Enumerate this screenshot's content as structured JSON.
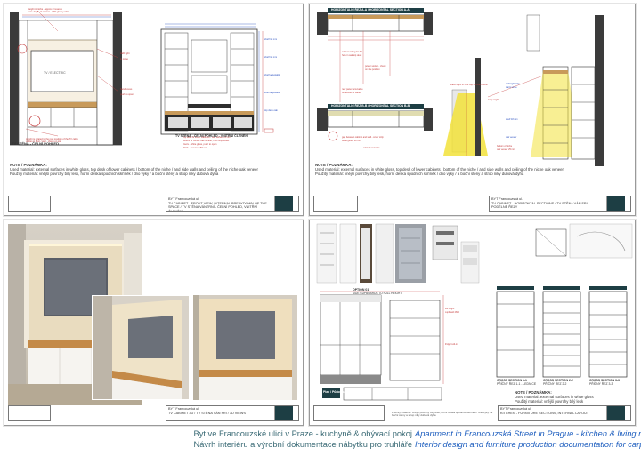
{
  "sheets": {
    "top_left": {
      "labels": {
        "view_left": "TV STĚNA - ČELNÍ POHLED",
        "view_right": "TV STĚNA - ČELNÍ POHLED - VNITŘNÍ ČLENĚNÍ"
      },
      "note_title": "NOTE / POZNÁMKA:",
      "note_en": "Used material: external surfaces in white gloss, top desk of lower cabinets / bottom of the niche / and side walls and ceiling of the niche oak veneer",
      "note_cz": "Použitý materiál: vnější povrchy bílý lesk, horní deska spodních skříněk / dno výky / a boční stěny a strop niky dubová dýha",
      "title_block": {
        "company": "BYT Francouzská ul.",
        "description": "TV CABINET - FRONT VIEW, INTERNAL BREAKDOWN OF THE SPACE / TV STĚNA VÁNTRNÍ - ČELNÍ POHLED, VNITŘNÍ ČLENĚNÍ"
      }
    },
    "top_right": {
      "labels": {
        "plan_a": "HORIZONTÁLNÍ ŘEZ A-A / HORIZONTAL SECTION A-A",
        "plan_b": "HORIZONTÁLNÍ ŘEZ B-B / HORIZONTAL SECTION B-B",
        "light_note": "LED light in the top of the niche"
      },
      "note_title": "NOTE / POZNÁMKA:",
      "note_en": "Used material: external surfaces in white gloss, top desk of lower cabinets / bottom of the niche / and side walls and ceiling of the niche oak veneer",
      "note_cz": "Použitý materiál: vnější povrchy bílý lesk, horní deska spodních skříněk / dno výky / a boční stěny a strop niky dubová dýha",
      "title_block": {
        "company": "BYT Francouzská ul.",
        "description": "TV CABINET - HORIZONTAL SECTIONS / TV STĚNA VÁN FRI - PODÉLNÉ ŘEZY"
      }
    },
    "bottom_left": {
      "title_block": {
        "company": "BYT Francouzská ul.",
        "description": "TV CABINET 3D / TV STĚNA VÁN FRI / 3D VIEWS"
      }
    },
    "bottom_right": {
      "labels": {
        "option": "OPTION 01",
        "option_desc": "SIDE CUPBOARDS TO FULL HEIGHT",
        "section_1": "CROSS SECTION 1-1",
        "section_1_cz": "PŘÍČNÝ ŘEZ 1-1 - LEDNICE",
        "section_2": "CROSS SECTION 2-2",
        "section_2_cz": "PŘÍČNÝ ŘEZ 2-2",
        "section_3": "CROSS SECTION 3-3",
        "section_3_cz": "PŘÍČNÝ ŘEZ 3-3",
        "plan": "Plan / Půdorys",
        "sprinkler_label": "Wall spacer"
      },
      "note_title": "NOTE / POZNÁMKA:",
      "note_en": "Used material: external surfaces in white gloss",
      "note_cz": "Použitý materiál: vnější povrchy bílý lesk",
      "footer_note": "Použitý materiál: vnější povrchy bílý lesk, horní deska spodních skříněk / dno výky / a boční stěny a strop niky dubová dýha",
      "title_block": {
        "company": "BYT Francouzská ul.",
        "description": "KITCHEN - FURNITURE SECTIONS, INTERNAL LAYOUT"
      }
    }
  },
  "caption": {
    "cz_line1": "Byt ve Francouzské ulici v Praze - kuchyně & obývací pokoj",
    "cz_line2": "Návrh interiéru a výrobní dokumentace nábytku pro truhláře",
    "en_line1": "Apartment in Francouzská Street in Prague - kitchen & living room",
    "en_line2": "Interior design and furniture production documentation for carpenter"
  },
  "colors": {
    "caption_cz": "#3a6a75",
    "caption_en": "#1f5fbf",
    "dimension_red": "#c43a3a",
    "dimension_blue": "#2a4fbf",
    "oak": "#c89a5a",
    "led_yellow": "#f2e23a",
    "title_logo": "#1d3e44"
  }
}
